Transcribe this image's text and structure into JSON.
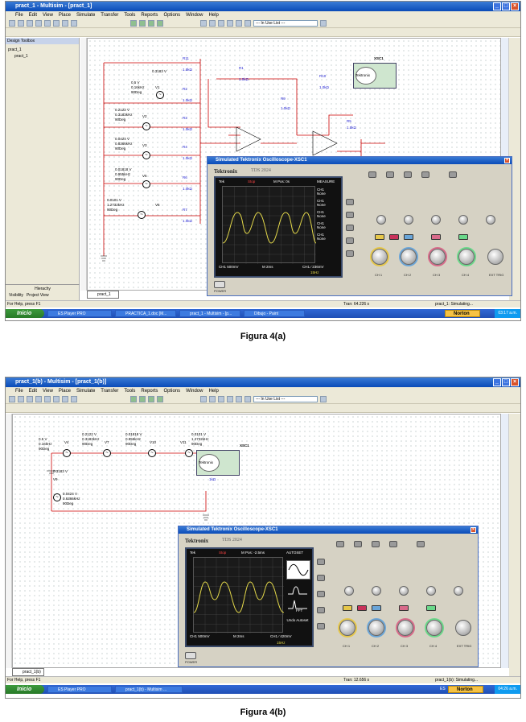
{
  "shot_a": {
    "title": "pract_1 - Multisim - [pract_1]",
    "menu": [
      "File",
      "Edit",
      "View",
      "Place",
      "Simulate",
      "Transfer",
      "Tools",
      "Reports",
      "Options",
      "Window",
      "Help"
    ],
    "inuse": "--- In Use List ---",
    "toolbox": "Design Toolbox",
    "tree": [
      "pract_1",
      "pract_1"
    ],
    "tabs": [
      "Hierachy",
      "Visibility",
      "Project View"
    ],
    "sheet_tab": "pract_1",
    "status_left": "For Help, press F1",
    "status_tran": "Tran: 64.226 s",
    "status_sim": "pract_1: Simulating...",
    "taskbar": {
      "start": "Inicio",
      "tasks": [
        "ES Player PRO",
        "PRACTICA_1.doc [M...",
        "pract_1 - Multisim - [p...",
        "Dibujo - Paint"
      ],
      "norton": "Norton",
      "time": "03:17 a.m."
    },
    "circuit": {
      "labels": [
        "R11",
        "1.0kΩ",
        "0.3183 V",
        "R1",
        "1.0kΩ",
        "0.5 V",
        "0.16kHz",
        "90Deg",
        "V1",
        "R2",
        "1.0kΩ",
        "R10",
        "1.0kΩ",
        "R9",
        "1.0kΩ",
        "0.2122 V",
        "0.3183kHz",
        "90Deg",
        "V2",
        "R3",
        "1.0kΩ",
        "R5",
        "1.0kΩ",
        "0.0424 V",
        "0.8366kHz",
        "90Deg",
        "V3",
        "R4",
        "1.0kΩ",
        "0.01818 V",
        "0.955kHz",
        "90Deg",
        "V5",
        "R6",
        "1.0kΩ",
        "0.0101 V",
        "1.2732kHz",
        "90Deg",
        "V6",
        "R7",
        "1.0kΩ",
        "XSC1",
        "Tektronix"
      ]
    },
    "scope": {
      "title": "Simulated Tektronix Oscilloscope-XSC1",
      "brand": "Tektronix",
      "model": "TDS 2024",
      "top": [
        "Tek",
        "Stop",
        "M Pos: 0s",
        "MEASURE"
      ],
      "menu": [
        [
          "CH1",
          "None"
        ],
        [
          "CH1",
          "None"
        ],
        [
          "CH1",
          "None"
        ],
        [
          "CH1",
          "None"
        ],
        [
          "CH1",
          "None"
        ]
      ],
      "bottom": [
        "CH1  500mV",
        "M 2ms",
        "CH1 ⁄ 236mV",
        "15Hz"
      ],
      "channels": [
        "CH 1",
        "CH 2",
        "CH 3",
        "CH 4",
        "EXT TRIG"
      ],
      "power": "POWER"
    }
  },
  "caption_a": "Figura 4(a)",
  "shot_b": {
    "title": "pract_1(b) - Multisim - [pract_1(b)]",
    "menu": [
      "File",
      "Edit",
      "View",
      "Place",
      "Simulate",
      "Transfer",
      "Tools",
      "Reports",
      "Options",
      "Window",
      "Help"
    ],
    "inuse": "--- In Use List ---",
    "sheet_tab": "pract_1(b)",
    "status_left": "For Help, press F1",
    "status_tran": "Tran: 12.656 s",
    "status_sim": "pract_1(b): Simulating...",
    "taskbar": {
      "start": "Inicio",
      "tasks": [
        "ES Player PRO",
        "pract_1(b) - Multisim ..."
      ],
      "lang": "ES",
      "norton": "Norton",
      "time": "04:26 a.m."
    },
    "circuit": {
      "labels": [
        "0.5 V",
        "0.16kHz",
        "90Deg",
        "V4",
        "0.2122 V",
        "0.3183kHz",
        "90Deg",
        "V7",
        "0.01818 V",
        "0.955kHz",
        "90Deg",
        "V10",
        "0.0101 V",
        "1.2732kHz",
        "90Deg",
        "V11",
        "XSC1",
        "0.3183 V",
        "V9",
        "R8",
        "1kΩ",
        "0.0424 V",
        "0.6366kHz",
        "90Deg",
        "Tektronix"
      ]
    },
    "scope": {
      "title": "Simulated Tektronix Oscilloscope-XSC1",
      "brand": "Tektronix",
      "model": "TDS 2024",
      "top": [
        "Tek",
        "Stop",
        "M Pos: -2.5ms",
        "AUTOSET"
      ],
      "menu": [
        "FFT",
        "Undo Autoset"
      ],
      "bottom": [
        "CH1  500mV",
        "M 2ms",
        "CH1 ⁄ 420mV",
        "15Hz"
      ],
      "channels": [
        "CH 1",
        "CH 2",
        "CH 3",
        "CH 4",
        "EXT TRIG"
      ],
      "power": "POWER"
    }
  },
  "caption_b": "Figura 4(b)"
}
